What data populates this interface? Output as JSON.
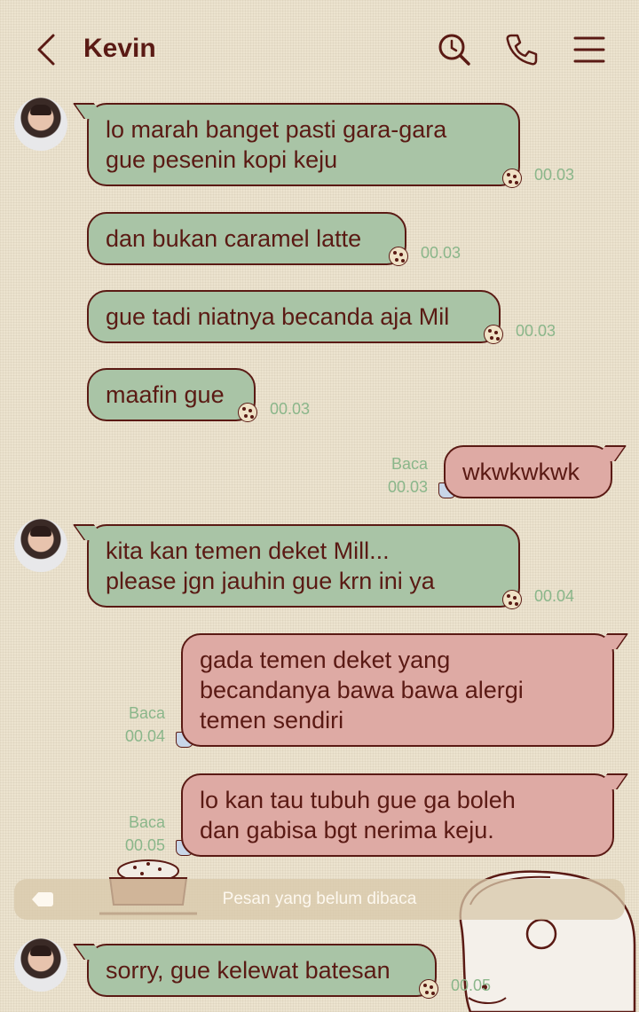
{
  "header": {
    "contact_name": "Kevin",
    "back_icon": "chevron-left-icon",
    "search_icon": "search-icon",
    "call_icon": "phone-icon",
    "menu_icon": "menu-icon"
  },
  "colors": {
    "incoming_bubble": "#a9c4a6",
    "outgoing_bubble": "#deaaa4",
    "text": "#5a1a14",
    "meta": "#8ab68a"
  },
  "messages": [
    {
      "from": "Kevin",
      "text": "lo marah banget pasti gara-gara\ngue pesenin kopi keju",
      "time": "00.03"
    },
    {
      "from": "Kevin",
      "text": "dan bukan caramel latte",
      "time": "00.03"
    },
    {
      "from": "Kevin",
      "text": "gue tadi niatnya becanda aja Mil",
      "time": "00.03"
    },
    {
      "from": "Kevin",
      "text": "maafin gue",
      "time": "00.03"
    },
    {
      "from": "me",
      "text": "wkwkwkwk",
      "time": "00.03",
      "status": "Baca"
    },
    {
      "from": "Kevin",
      "text": "kita kan temen deket Mill...\nplease jgn jauhin gue krn ini ya",
      "time": "00.04"
    },
    {
      "from": "me",
      "text": "gada temen deket yang\nbecandanya bawa bawa alergi\ntemen sendiri",
      "time": "00.04",
      "status": "Baca"
    },
    {
      "from": "me",
      "text": "lo kan tau tubuh gue ga boleh\ndan gabisa bgt nerima keju.",
      "time": "00.05",
      "status": "Baca"
    },
    {
      "from": "Kevin",
      "text": "sorry, gue kelewat batesan",
      "time": "00.05"
    }
  ],
  "unread_divider": "Pesan yang belum dibaca"
}
